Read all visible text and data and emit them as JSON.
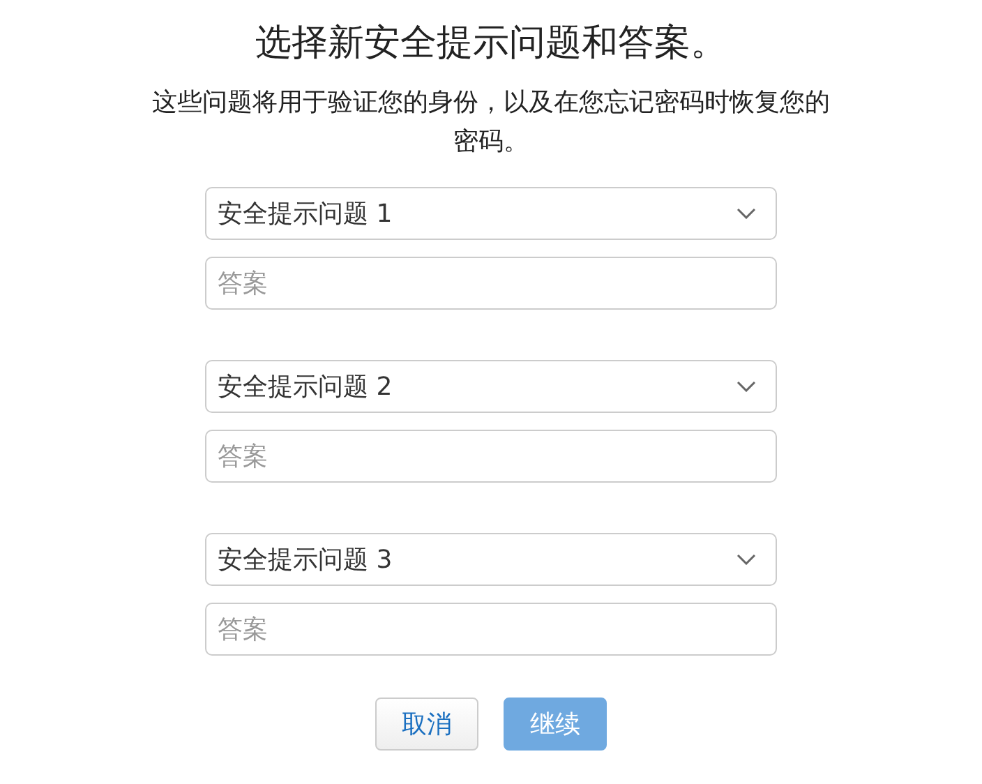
{
  "title": "选择新安全提示问题和答案。",
  "description": "这些问题将用于验证您的身份，以及在您忘记密码时恢复您的密码。",
  "questions": [
    {
      "select": "安全提示问题 1",
      "answer_placeholder": "答案"
    },
    {
      "select": "安全提示问题 2",
      "answer_placeholder": "答案"
    },
    {
      "select": "安全提示问题 3",
      "answer_placeholder": "答案"
    }
  ],
  "buttons": [
    {
      "label": "取消",
      "kind": "secondary",
      "disabled": false
    },
    {
      "label": "继续",
      "kind": "primary",
      "disabled": true
    }
  ]
}
